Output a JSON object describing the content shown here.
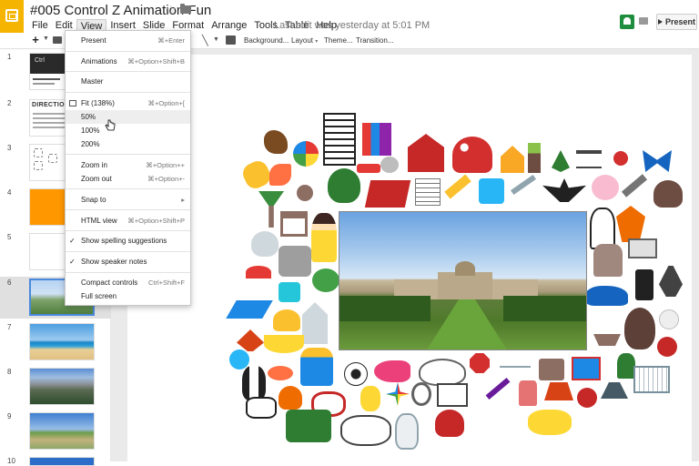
{
  "app": {
    "title": "#005 Control Z Animation Fun",
    "last_edit": "Last edit was yesterday at 5:01 PM",
    "present_label": "Present"
  },
  "menubar": [
    "File",
    "Edit",
    "View",
    "Insert",
    "Slide",
    "Format",
    "Arrange",
    "Tools",
    "Table",
    "Help"
  ],
  "toolbar": {
    "plus": "+",
    "background": "Background...",
    "layout": "Layout",
    "theme": "Theme...",
    "transition": "Transition..."
  },
  "view_menu": {
    "present": {
      "label": "Present",
      "shortcut": "⌘+Enter"
    },
    "animations": {
      "label": "Animations",
      "shortcut": "⌘+Option+Shift+B"
    },
    "master": {
      "label": "Master"
    },
    "fit": {
      "label": "Fit (138%)",
      "shortcut": "⌘+Option+["
    },
    "z50": {
      "label": "50%"
    },
    "z100": {
      "label": "100%"
    },
    "z200": {
      "label": "200%"
    },
    "zoom_in": {
      "label": "Zoom in",
      "shortcut": "⌘+Option++"
    },
    "zoom_out": {
      "label": "Zoom out",
      "shortcut": "⌘+Option+-"
    },
    "snap_to": {
      "label": "Snap to",
      "shortcut": "▸"
    },
    "html_view": {
      "label": "HTML view",
      "shortcut": "⌘+Option+Shift+P"
    },
    "spelling": {
      "label": "Show spelling suggestions",
      "check": "✓"
    },
    "speaker": {
      "label": "Show speaker notes",
      "check": "✓"
    },
    "compact": {
      "label": "Compact controls",
      "shortcut": "Ctrl+Shift+F"
    },
    "full_screen": {
      "label": "Full screen"
    }
  },
  "slides": {
    "numbers": [
      "1",
      "2",
      "3",
      "4",
      "5",
      "6",
      "7",
      "8",
      "9",
      "10"
    ],
    "s1_text": "Ctrl",
    "s2_heading": "DIRECTIONS"
  },
  "colors": {
    "accent": "#f4b400",
    "selection": "#4a89dc",
    "slide4": "#ff9800"
  },
  "icons": [
    "slides-logo-icon",
    "star-icon",
    "folder-icon",
    "share-icon",
    "comment-icon",
    "present-icon",
    "print-icon",
    "line-icon",
    "fit-icon"
  ]
}
